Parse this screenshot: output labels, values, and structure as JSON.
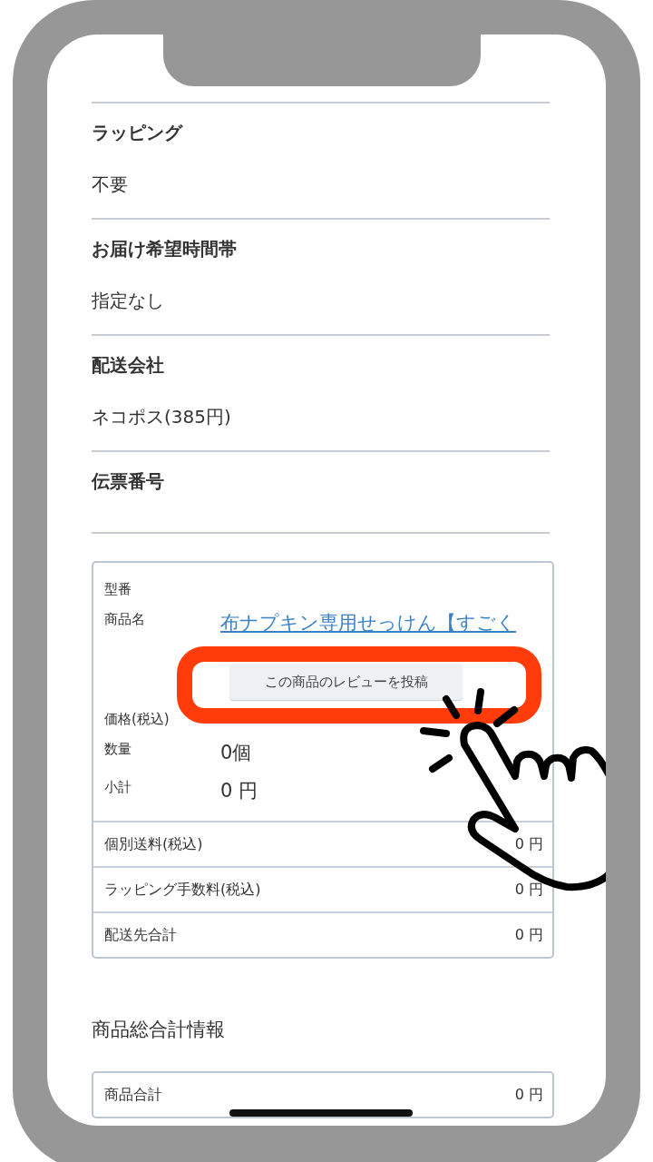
{
  "sections": [
    {
      "title": "ラッピング",
      "value": "不要"
    },
    {
      "title": "お届け希望時間帯",
      "value": "指定なし"
    },
    {
      "title": "配送会社",
      "value": "ネコポス(385円)"
    },
    {
      "title": "伝票番号"
    }
  ],
  "order_item": {
    "fields": [
      {
        "label": "型番"
      },
      {
        "label": "商品名",
        "link": "布ナプキン専用せっけん【すごく",
        "button": "この商品のレビューを投稿"
      },
      {
        "label": "価格(税込)"
      },
      {
        "label": "数量",
        "value": "0個"
      },
      {
        "label": "小計",
        "value": "0 円"
      }
    ],
    "summary_rows": [
      {
        "label": "個別送料(税込)",
        "value": "0 円"
      },
      {
        "label": "ラッピング手数料(税込)",
        "value": "0 円"
      },
      {
        "label": "配送先合計",
        "value": "0 円"
      }
    ]
  },
  "totals": {
    "heading": "商品総合計情報",
    "rows": [
      {
        "label": "商品合計",
        "value": "0 円"
      }
    ]
  }
}
